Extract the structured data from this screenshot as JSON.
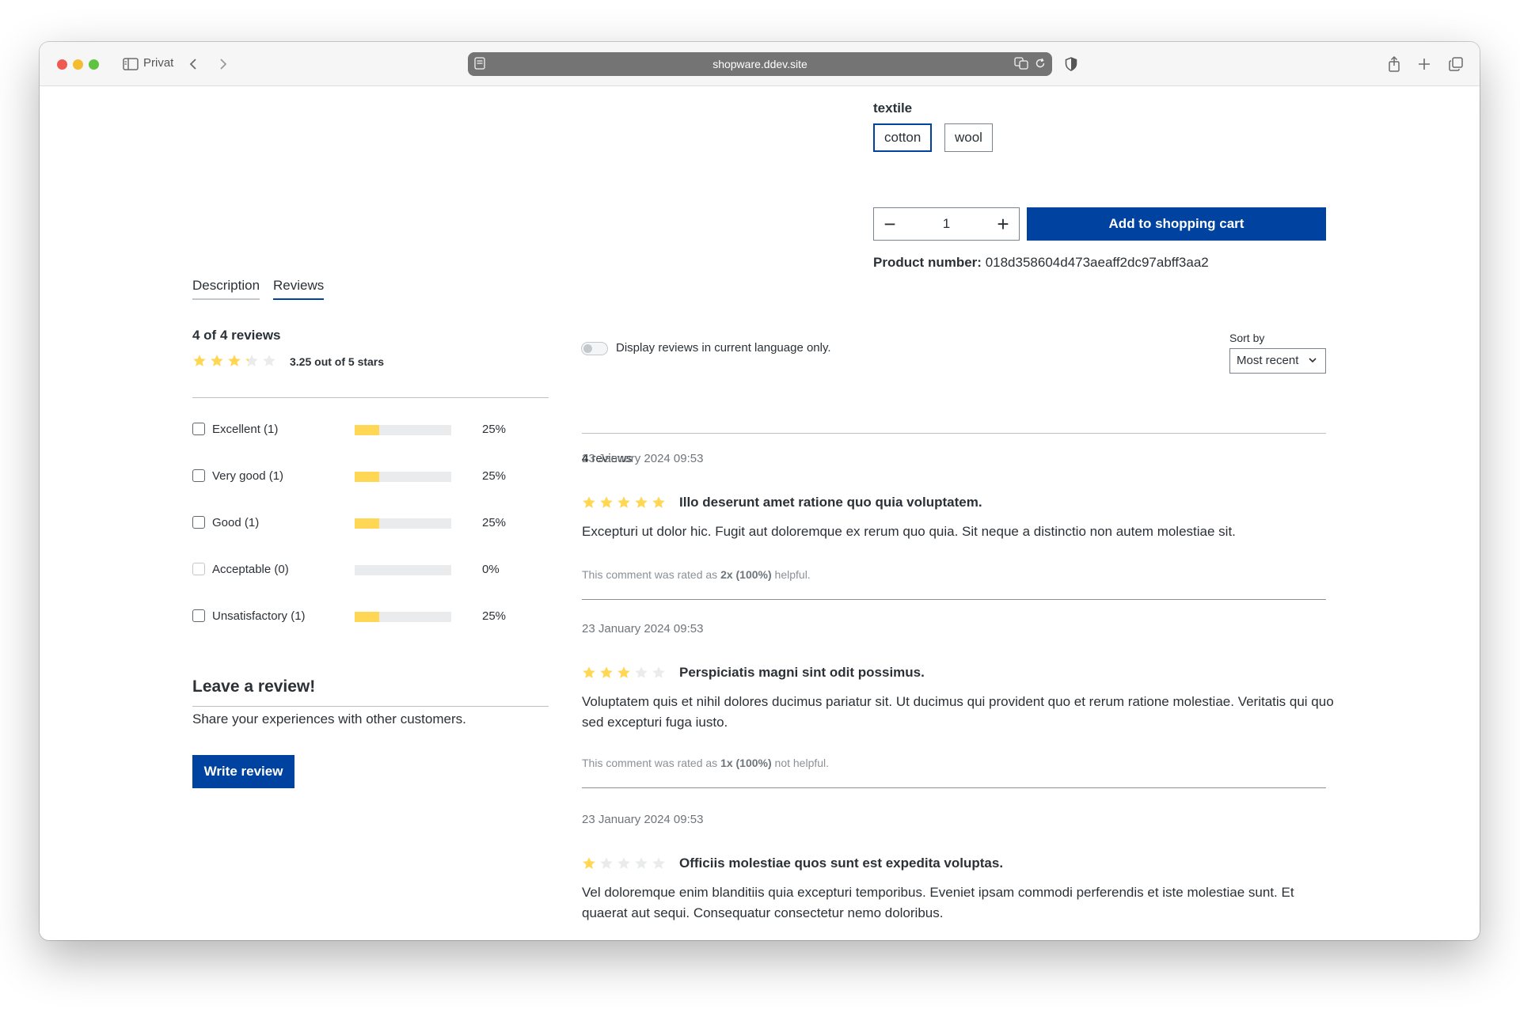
{
  "browser": {
    "profile_label": "Privat",
    "url": "shopware.ddev.site"
  },
  "product": {
    "property_title": "textile",
    "options": [
      "cotton",
      "wool"
    ],
    "selected_option": "cotton",
    "quantity": "1",
    "qty_minus": "−",
    "qty_plus": "+",
    "add_to_cart_label": "Add to shopping cart",
    "product_number_label": "Product number:",
    "product_number": "018d358604d473aeaff2dc97abff3aa2"
  },
  "tabs": [
    "Description",
    "Reviews"
  ],
  "active_tab": "Reviews",
  "summary": {
    "count_text": "4 of 4 reviews",
    "rating": 3.25,
    "rating_text": "3.25 out of 5 stars",
    "filters": [
      {
        "label": "Excellent (1)",
        "percent_text": "25%",
        "percent": 25,
        "enabled": true
      },
      {
        "label": "Very good (1)",
        "percent_text": "25%",
        "percent": 25,
        "enabled": true
      },
      {
        "label": "Good (1)",
        "percent_text": "25%",
        "percent": 25,
        "enabled": true
      },
      {
        "label": "Acceptable (0)",
        "percent_text": "0%",
        "percent": 0,
        "enabled": false
      },
      {
        "label": "Unsatisfactory (1)",
        "percent_text": "25%",
        "percent": 25,
        "enabled": true
      }
    ]
  },
  "leave_review": {
    "title": "Leave a review!",
    "text": "Share your experiences with other customers.",
    "button": "Write review"
  },
  "list": {
    "language_toggle_label": "Display reviews in current language only.",
    "language_toggle_on": false,
    "sort_label": "Sort by",
    "sort_value": "Most recent",
    "total_number": "4",
    "total_suffix": " reviews"
  },
  "reviews": [
    {
      "date": "23 January 2024 09:53",
      "rating": 5,
      "title": "Illo deserunt amet ratione quo quia voluptatem.",
      "text": "Excepturi ut dolor hic. Fugit aut doloremque ex rerum quo quia. Sit neque a distinctio non autem molestiae sit.",
      "help_prefix": "This comment was rated as ",
      "help_value": "2x (100%)",
      "help_suffix": " helpful."
    },
    {
      "date": "23 January 2024 09:53",
      "rating": 3,
      "title": "Perspiciatis magni sint odit possimus.",
      "text": "Voluptatem quis et nihil dolores ducimus pariatur sit. Ut ducimus qui provident quo et rerum ratione molestiae. Veritatis qui quo sed excepturi fuga iusto.",
      "help_prefix": "This comment was rated as ",
      "help_value": "1x (100%)",
      "help_suffix": " not helpful."
    },
    {
      "date": "23 January 2024 09:53",
      "rating": 1,
      "title": "Officiis molestiae quos sunt est expedita voluptas.",
      "text": "Vel doloremque enim blanditiis quia excepturi temporibus. Eveniet ipsam commodi perferendis et iste molestiae sunt. Et quaerat aut sequi. Consequatur consectetur nemo doloribus."
    }
  ],
  "colors": {
    "primary": "#0042a0",
    "star_filled": "#ffd755",
    "star_empty": "#eaebec",
    "text": "#2b3136",
    "muted": "#6d757b"
  }
}
